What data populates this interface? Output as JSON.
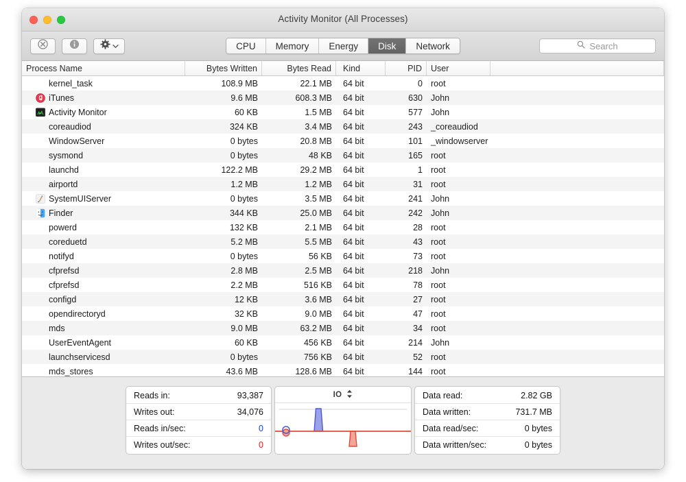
{
  "window": {
    "title": "Activity Monitor (All Processes)",
    "traffic_lights": [
      "close-button",
      "minimize-button",
      "zoom-button"
    ]
  },
  "toolbar": {
    "quit_process_icon": "stop-process-icon",
    "inspect_icon": "info-icon",
    "gear_icon": "gear-icon",
    "gear_chevron_icon": "chevron-down-icon",
    "tabs": [
      {
        "label": "CPU",
        "active": false
      },
      {
        "label": "Memory",
        "active": false
      },
      {
        "label": "Energy",
        "active": false
      },
      {
        "label": "Disk",
        "active": true
      },
      {
        "label": "Network",
        "active": false
      }
    ],
    "search": {
      "icon": "search-icon",
      "placeholder": "Search",
      "value": ""
    }
  },
  "table": {
    "columns": [
      {
        "key": "name",
        "label": "Process Name",
        "align": "left"
      },
      {
        "key": "bytes_written",
        "label": "Bytes Written",
        "align": "right"
      },
      {
        "key": "bytes_read",
        "label": "Bytes Read",
        "align": "right"
      },
      {
        "key": "kind",
        "label": "Kind",
        "align": "left"
      },
      {
        "key": "pid",
        "label": "PID",
        "align": "right"
      },
      {
        "key": "user",
        "label": "User",
        "align": "left"
      }
    ],
    "rows": [
      {
        "name": "kernel_task",
        "icon": "",
        "bytes_written": "108.9 MB",
        "bytes_read": "22.1 MB",
        "kind": "64 bit",
        "pid": "0",
        "user": "root"
      },
      {
        "name": "iTunes",
        "icon": "itunes-icon",
        "bytes_written": "9.6 MB",
        "bytes_read": "608.3 MB",
        "kind": "64 bit",
        "pid": "630",
        "user": "John"
      },
      {
        "name": "Activity Monitor",
        "icon": "activity-monitor-icon",
        "bytes_written": "60 KB",
        "bytes_read": "1.5 MB",
        "kind": "64 bit",
        "pid": "577",
        "user": "John"
      },
      {
        "name": "coreaudiod",
        "icon": "",
        "bytes_written": "324 KB",
        "bytes_read": "3.4 MB",
        "kind": "64 bit",
        "pid": "243",
        "user": "_coreaudiod"
      },
      {
        "name": "WindowServer",
        "icon": "",
        "bytes_written": "0 bytes",
        "bytes_read": "20.8 MB",
        "kind": "64 bit",
        "pid": "101",
        "user": "_windowserver"
      },
      {
        "name": "sysmond",
        "icon": "",
        "bytes_written": "0 bytes",
        "bytes_read": "48 KB",
        "kind": "64 bit",
        "pid": "165",
        "user": "root"
      },
      {
        "name": "launchd",
        "icon": "",
        "bytes_written": "122.2 MB",
        "bytes_read": "29.2 MB",
        "kind": "64 bit",
        "pid": "1",
        "user": "root"
      },
      {
        "name": "airportd",
        "icon": "",
        "bytes_written": "1.2 MB",
        "bytes_read": "1.2 MB",
        "kind": "64 bit",
        "pid": "31",
        "user": "root"
      },
      {
        "name": "SystemUIServer",
        "icon": "systemuiserver-icon",
        "bytes_written": "0 bytes",
        "bytes_read": "3.5 MB",
        "kind": "64 bit",
        "pid": "241",
        "user": "John"
      },
      {
        "name": "Finder",
        "icon": "finder-icon",
        "bytes_written": "344 KB",
        "bytes_read": "25.0 MB",
        "kind": "64 bit",
        "pid": "242",
        "user": "John"
      },
      {
        "name": "powerd",
        "icon": "",
        "bytes_written": "132 KB",
        "bytes_read": "2.1 MB",
        "kind": "64 bit",
        "pid": "28",
        "user": "root"
      },
      {
        "name": "coreduetd",
        "icon": "",
        "bytes_written": "5.2 MB",
        "bytes_read": "5.5 MB",
        "kind": "64 bit",
        "pid": "43",
        "user": "root"
      },
      {
        "name": "notifyd",
        "icon": "",
        "bytes_written": "0 bytes",
        "bytes_read": "56 KB",
        "kind": "64 bit",
        "pid": "73",
        "user": "root"
      },
      {
        "name": "cfprefsd",
        "icon": "",
        "bytes_written": "2.8 MB",
        "bytes_read": "2.5 MB",
        "kind": "64 bit",
        "pid": "218",
        "user": "John"
      },
      {
        "name": "cfprefsd",
        "icon": "",
        "bytes_written": "2.2 MB",
        "bytes_read": "516 KB",
        "kind": "64 bit",
        "pid": "78",
        "user": "root"
      },
      {
        "name": "configd",
        "icon": "",
        "bytes_written": "12 KB",
        "bytes_read": "3.6 MB",
        "kind": "64 bit",
        "pid": "27",
        "user": "root"
      },
      {
        "name": "opendirectoryd",
        "icon": "",
        "bytes_written": "32 KB",
        "bytes_read": "9.0 MB",
        "kind": "64 bit",
        "pid": "47",
        "user": "root"
      },
      {
        "name": "mds",
        "icon": "",
        "bytes_written": "9.0 MB",
        "bytes_read": "63.2 MB",
        "kind": "64 bit",
        "pid": "34",
        "user": "root"
      },
      {
        "name": "UserEventAgent",
        "icon": "",
        "bytes_written": "60 KB",
        "bytes_read": "456 KB",
        "kind": "64 bit",
        "pid": "214",
        "user": "John"
      },
      {
        "name": "launchservicesd",
        "icon": "",
        "bytes_written": "0 bytes",
        "bytes_read": "756 KB",
        "kind": "64 bit",
        "pid": "52",
        "user": "root"
      },
      {
        "name": "mds_stores",
        "icon": "",
        "bytes_written": "43.6 MB",
        "bytes_read": "128.6 MB",
        "kind": "64 bit",
        "pid": "144",
        "user": "root"
      }
    ]
  },
  "footer": {
    "left_stats": [
      {
        "label": "Reads in:",
        "value": "93,387",
        "color": "default"
      },
      {
        "label": "Writes out:",
        "value": "34,076",
        "color": "default"
      },
      {
        "label": "Reads in/sec:",
        "value": "0",
        "color": "blue"
      },
      {
        "label": "Writes out/sec:",
        "value": "0",
        "color": "red"
      }
    ],
    "graph": {
      "title": "IO",
      "stepper_icon": "up-down-chevron-icon",
      "read_color": "#4a58d8",
      "write_color": "#e24a3a"
    },
    "right_stats": [
      {
        "label": "Data read:",
        "value": "2.82 GB",
        "color": "default"
      },
      {
        "label": "Data written:",
        "value": "731.7 MB",
        "color": "default"
      },
      {
        "label": "Data read/sec:",
        "value": "0 bytes",
        "color": "default"
      },
      {
        "label": "Data written/sec:",
        "value": "0 bytes",
        "color": "default"
      }
    ]
  }
}
